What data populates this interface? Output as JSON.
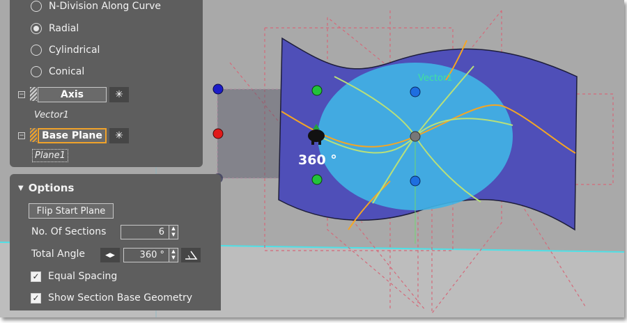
{
  "radio_options": [
    {
      "label": "N-Division Along Curve",
      "checked": false
    },
    {
      "label": "Radial",
      "checked": true
    },
    {
      "label": "Cylindrical",
      "checked": false
    },
    {
      "label": "Conical",
      "checked": false
    }
  ],
  "axis": {
    "button_label": "Axis",
    "value": "Vector1"
  },
  "base_plane": {
    "button_label": "Base Plane",
    "value": "Plane1"
  },
  "options": {
    "title": "Options",
    "flip_start_plane": "Flip Start Plane",
    "sections_label": "No. Of Sections",
    "sections_value": "6",
    "angle_label": "Total Angle",
    "angle_value": "360 °",
    "equal_spacing": {
      "label": "Equal Spacing",
      "checked": true
    },
    "show_geometry": {
      "label": "Show Section Base Geometry",
      "checked": true
    }
  },
  "viewport": {
    "angle_readout": "360 °",
    "vector_label": "Vector1",
    "colors": {
      "background": "#a9a9a9",
      "floor": "#bdbdbd",
      "surface": "#4f4fb8",
      "disk": "#40b4e6",
      "curve_orange": "#f5a623",
      "curve_green": "#b8e07a",
      "dashed": "#d46a7a",
      "cyan_line": "#4fe0e6"
    }
  },
  "icons": {
    "collapse": "minus-box-icon",
    "settings": "asterisk-settings-icon",
    "spin": "spin-arrows-icon",
    "direction": "double-arrow-icon",
    "angle": "angle-icon",
    "check": "check-icon",
    "triangle": "triangle-down-icon"
  },
  "glyphs": {
    "collapse": "−",
    "settings": "✳",
    "up": "▲",
    "down": "▼",
    "check": "✓",
    "triangle": "▼",
    "direction": "◀▶"
  }
}
